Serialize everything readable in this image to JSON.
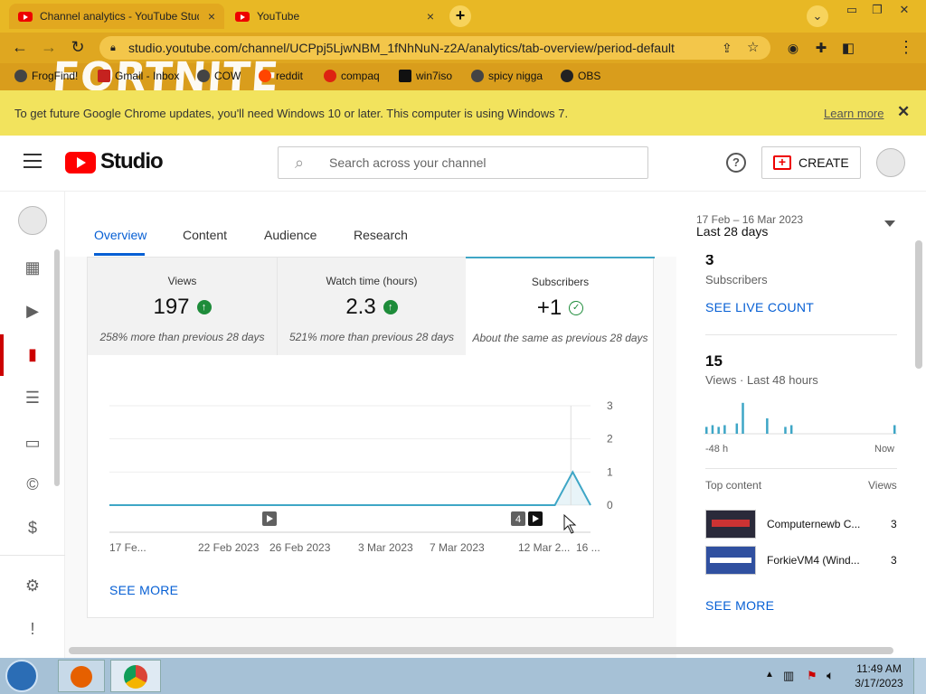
{
  "browser": {
    "tabs": [
      {
        "title": "Channel analytics - YouTube Studio",
        "close": "×"
      },
      {
        "title": "YouTube",
        "close": "×"
      }
    ],
    "new_tab": "+",
    "url": "studio.youtube.com/channel/UCPpj5LjwNBM_1fNhNuN-z2A/analytics/tab-overview/period-default",
    "bookmarks": [
      "FrogFind!",
      "Gmail - Inbox",
      "COW",
      "reddit",
      "compaq",
      "win7iso",
      "spicy nigga",
      "OBS"
    ],
    "theme_text": "FORTNITE",
    "infobar": {
      "message": "To get future Google Chrome updates, you'll need Windows 10 or later. This computer is using Windows 7.",
      "link": "Learn more"
    }
  },
  "studio": {
    "logo": "Studio",
    "search_placeholder": "Search across your channel",
    "create_label": "CREATE",
    "tabs": [
      "Overview",
      "Content",
      "Audience",
      "Research"
    ],
    "date_range": {
      "dates": "17 Feb – 16 Mar 2023",
      "label": "Last 28 days"
    },
    "metrics": [
      {
        "label": "Views",
        "value": "197",
        "comparison": "258% more than previous 28 days"
      },
      {
        "label": "Watch time (hours)",
        "value": "2.3",
        "comparison": "521% more than previous 28 days"
      },
      {
        "label": "Subscribers",
        "value": "+1",
        "comparison": "About the same as previous 28 days"
      }
    ],
    "see_more": "SEE MORE",
    "right_panel": {
      "subscribers_value": "3",
      "subscribers_label": "Subscribers",
      "live_count": "SEE LIVE COUNT",
      "views_value": "15",
      "views_label": "Views · Last 48 hours",
      "axis_left": "-48 h",
      "axis_right": "Now",
      "top_content_label": "Top content",
      "top_content_col": "Views",
      "top_content": [
        {
          "title": "Computernewb C...",
          "views": "3"
        },
        {
          "title": "ForkieVM4 (Wind...",
          "views": "3"
        }
      ],
      "see_more": "SEE MORE"
    }
  },
  "chart_data": {
    "type": "line",
    "x_ticks": [
      "17 Fe...",
      "22 Feb 2023",
      "26 Feb 2023",
      "3 Mar 2023",
      "7 Mar 2023",
      "12 Mar 2...",
      "16 ..."
    ],
    "y_ticks": [
      "3",
      "2",
      "1",
      "0"
    ],
    "ylim": [
      0,
      3
    ],
    "x": [
      "17 Feb",
      "18 Feb",
      "19 Feb",
      "20 Feb",
      "21 Feb",
      "22 Feb",
      "23 Feb",
      "24 Feb",
      "25 Feb",
      "26 Feb",
      "27 Feb",
      "28 Feb",
      "1 Mar",
      "2 Mar",
      "3 Mar",
      "4 Mar",
      "5 Mar",
      "6 Mar",
      "7 Mar",
      "8 Mar",
      "9 Mar",
      "10 Mar",
      "11 Mar",
      "12 Mar",
      "13 Mar",
      "14 Mar",
      "15 Mar",
      "16 Mar"
    ],
    "series": [
      {
        "values": [
          0,
          0,
          0,
          0,
          0,
          0,
          0,
          0,
          0,
          0,
          0,
          0,
          0,
          0,
          0,
          0,
          0,
          0,
          0,
          0,
          0,
          0,
          0,
          0,
          0,
          0,
          1,
          0
        ]
      }
    ],
    "markers": [
      "4"
    ],
    "line_color": "#3ea6c6"
  },
  "spark_data": {
    "values": [
      0.2,
      0.25,
      0.2,
      0.25,
      0,
      0.3,
      0.9,
      0,
      0,
      0,
      0.45,
      0,
      0,
      0.2,
      0.25,
      0,
      0,
      0,
      0,
      0,
      0,
      0,
      0,
      0,
      0,
      0,
      0,
      0,
      0,
      0,
      0,
      0.25
    ],
    "color": "#3ea6c6"
  },
  "taskbar": {
    "time": "11:49 AM",
    "date": "3/17/2023"
  }
}
